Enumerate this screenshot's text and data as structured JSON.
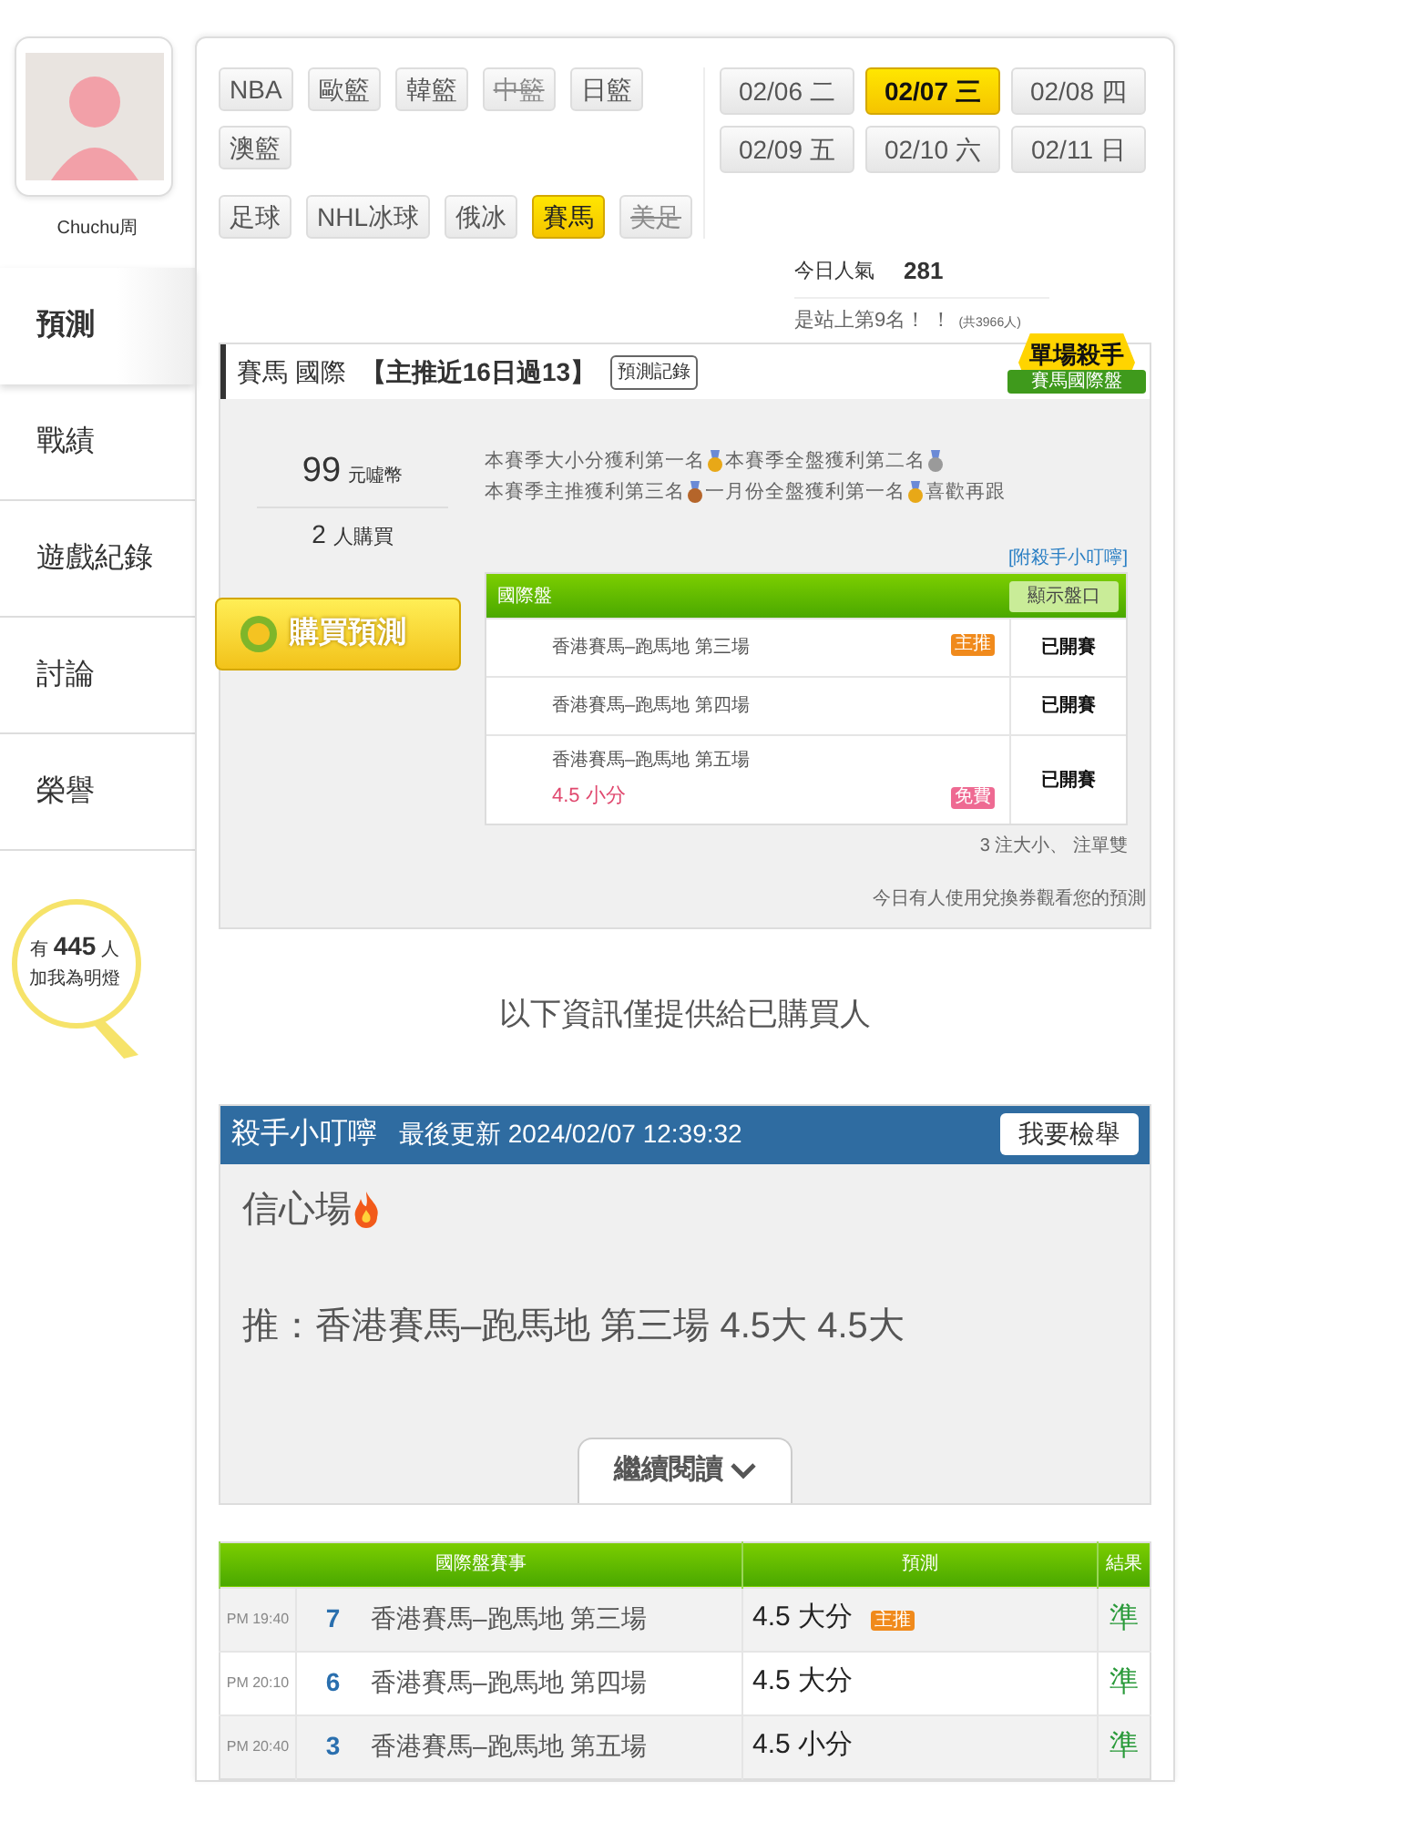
{
  "profile": {
    "name": "Chuchu周"
  },
  "nav": [
    {
      "label": "預測",
      "selected": true
    },
    {
      "label": "戰績",
      "selected": false
    },
    {
      "label": "遊戲紀錄",
      "selected": false
    },
    {
      "label": "討論",
      "selected": false
    },
    {
      "label": "榮譽",
      "selected": false
    }
  ],
  "fans": {
    "prefix": "有",
    "count": "445",
    "suffix": "人",
    "caption": "加我為明燈"
  },
  "sport_rows": [
    [
      {
        "label": "NBA",
        "selected": false,
        "disabled": false
      },
      {
        "label": "歐籃",
        "selected": false,
        "disabled": false
      },
      {
        "label": "韓籃",
        "selected": false,
        "disabled": false
      },
      {
        "label": "中籃",
        "selected": false,
        "disabled": true
      },
      {
        "label": "日籃",
        "selected": false,
        "disabled": false
      }
    ],
    [
      {
        "label": "澳籃",
        "selected": false,
        "disabled": false
      }
    ],
    [
      {
        "label": "足球",
        "selected": false,
        "disabled": false
      },
      {
        "label": "NHL冰球",
        "selected": false,
        "disabled": false
      },
      {
        "label": "俄冰",
        "selected": false,
        "disabled": false
      },
      {
        "label": "賽馬",
        "selected": true,
        "disabled": false
      },
      {
        "label": "美足",
        "selected": false,
        "disabled": true
      }
    ]
  ],
  "dates": [
    {
      "date": "02/06",
      "weekday": "二",
      "selected": false
    },
    {
      "date": "02/07",
      "weekday": "三",
      "selected": true
    },
    {
      "date": "02/08",
      "weekday": "四",
      "selected": false
    },
    {
      "date": "02/09",
      "weekday": "五",
      "selected": false
    },
    {
      "date": "02/10",
      "weekday": "六",
      "selected": false
    },
    {
      "date": "02/11",
      "weekday": "日",
      "selected": false
    }
  ],
  "popularity": {
    "label": "今日人氣",
    "value": "281",
    "rank": "是站上第9名！ ！",
    "total": "(共3966人)"
  },
  "pick_card": {
    "title": "賽馬 國際",
    "record": "【主推近16日過13】",
    "record_button": "預測記錄",
    "badge": {
      "title": "單場殺手",
      "ribbon": "賽馬國際盤"
    },
    "price": "99",
    "currency": "元噓幣",
    "buyers": "2",
    "buyers_label": "人購買",
    "buy_button": "購買預測",
    "honors": [
      {
        "text": "本賽季大小分獲利第一名",
        "color": "#e8a817"
      },
      {
        "text": "本賽季全盤獲利第二名",
        "color": "#9a9a9a"
      },
      {
        "text": "本賽季主推獲利第三名",
        "color": "#b5652a"
      },
      {
        "text": "一月份全盤獲利第一名",
        "color": "#e8a817"
      }
    ],
    "honors_end": "喜歡再跟",
    "tip_link": "[附殺手小叮嚀]",
    "market": {
      "title": "國際盤",
      "button": "顯示盤口",
      "games": [
        {
          "name": "香港賽馬–跑馬地 第三場",
          "tag": {
            "kind": "main",
            "label": "主推"
          },
          "status": "已開賽"
        },
        {
          "name": "香港賽馬–跑馬地 第四場",
          "status": "已開賽"
        },
        {
          "name": "香港賽馬–跑馬地 第五場",
          "pick": "4.5 小分",
          "tag": {
            "kind": "free",
            "label": "免費"
          },
          "status": "已開賽"
        }
      ]
    },
    "summary": "3 注大小、 注單雙",
    "notice": "今日有人使用兌換券觀看您的預測"
  },
  "members_notice": "以下資訊僅提供給已購買人",
  "tip": {
    "title": "殺手小叮嚀",
    "updated": "最後更新 2024/02/07 12:39:32",
    "report_button": "我要檢舉",
    "lines": [
      {
        "text": "信心場",
        "kind": "flagged"
      },
      {
        "text": "推：香港賽馬–跑馬地 第三場 4.5大 4.5大",
        "kind": "plain"
      }
    ],
    "read_more": "繼續閱讀"
  },
  "results": {
    "columns": [
      "國際盤賽事",
      "預測",
      "結果"
    ],
    "rows": [
      {
        "time": "PM 19:40",
        "number": "7",
        "game": "香港賽馬–跑馬地 第三場",
        "prediction": "4.5 大分",
        "tag": {
          "kind": "main",
          "label": "主推"
        },
        "result": "準"
      },
      {
        "time": "PM 20:10",
        "number": "6",
        "game": "香港賽馬–跑馬地 第四場",
        "prediction": "4.5 大分",
        "result": "準"
      },
      {
        "time": "PM 20:40",
        "number": "3",
        "game": "香港賽馬–跑馬地 第五場",
        "prediction": "4.5 小分",
        "result": "準"
      }
    ]
  }
}
